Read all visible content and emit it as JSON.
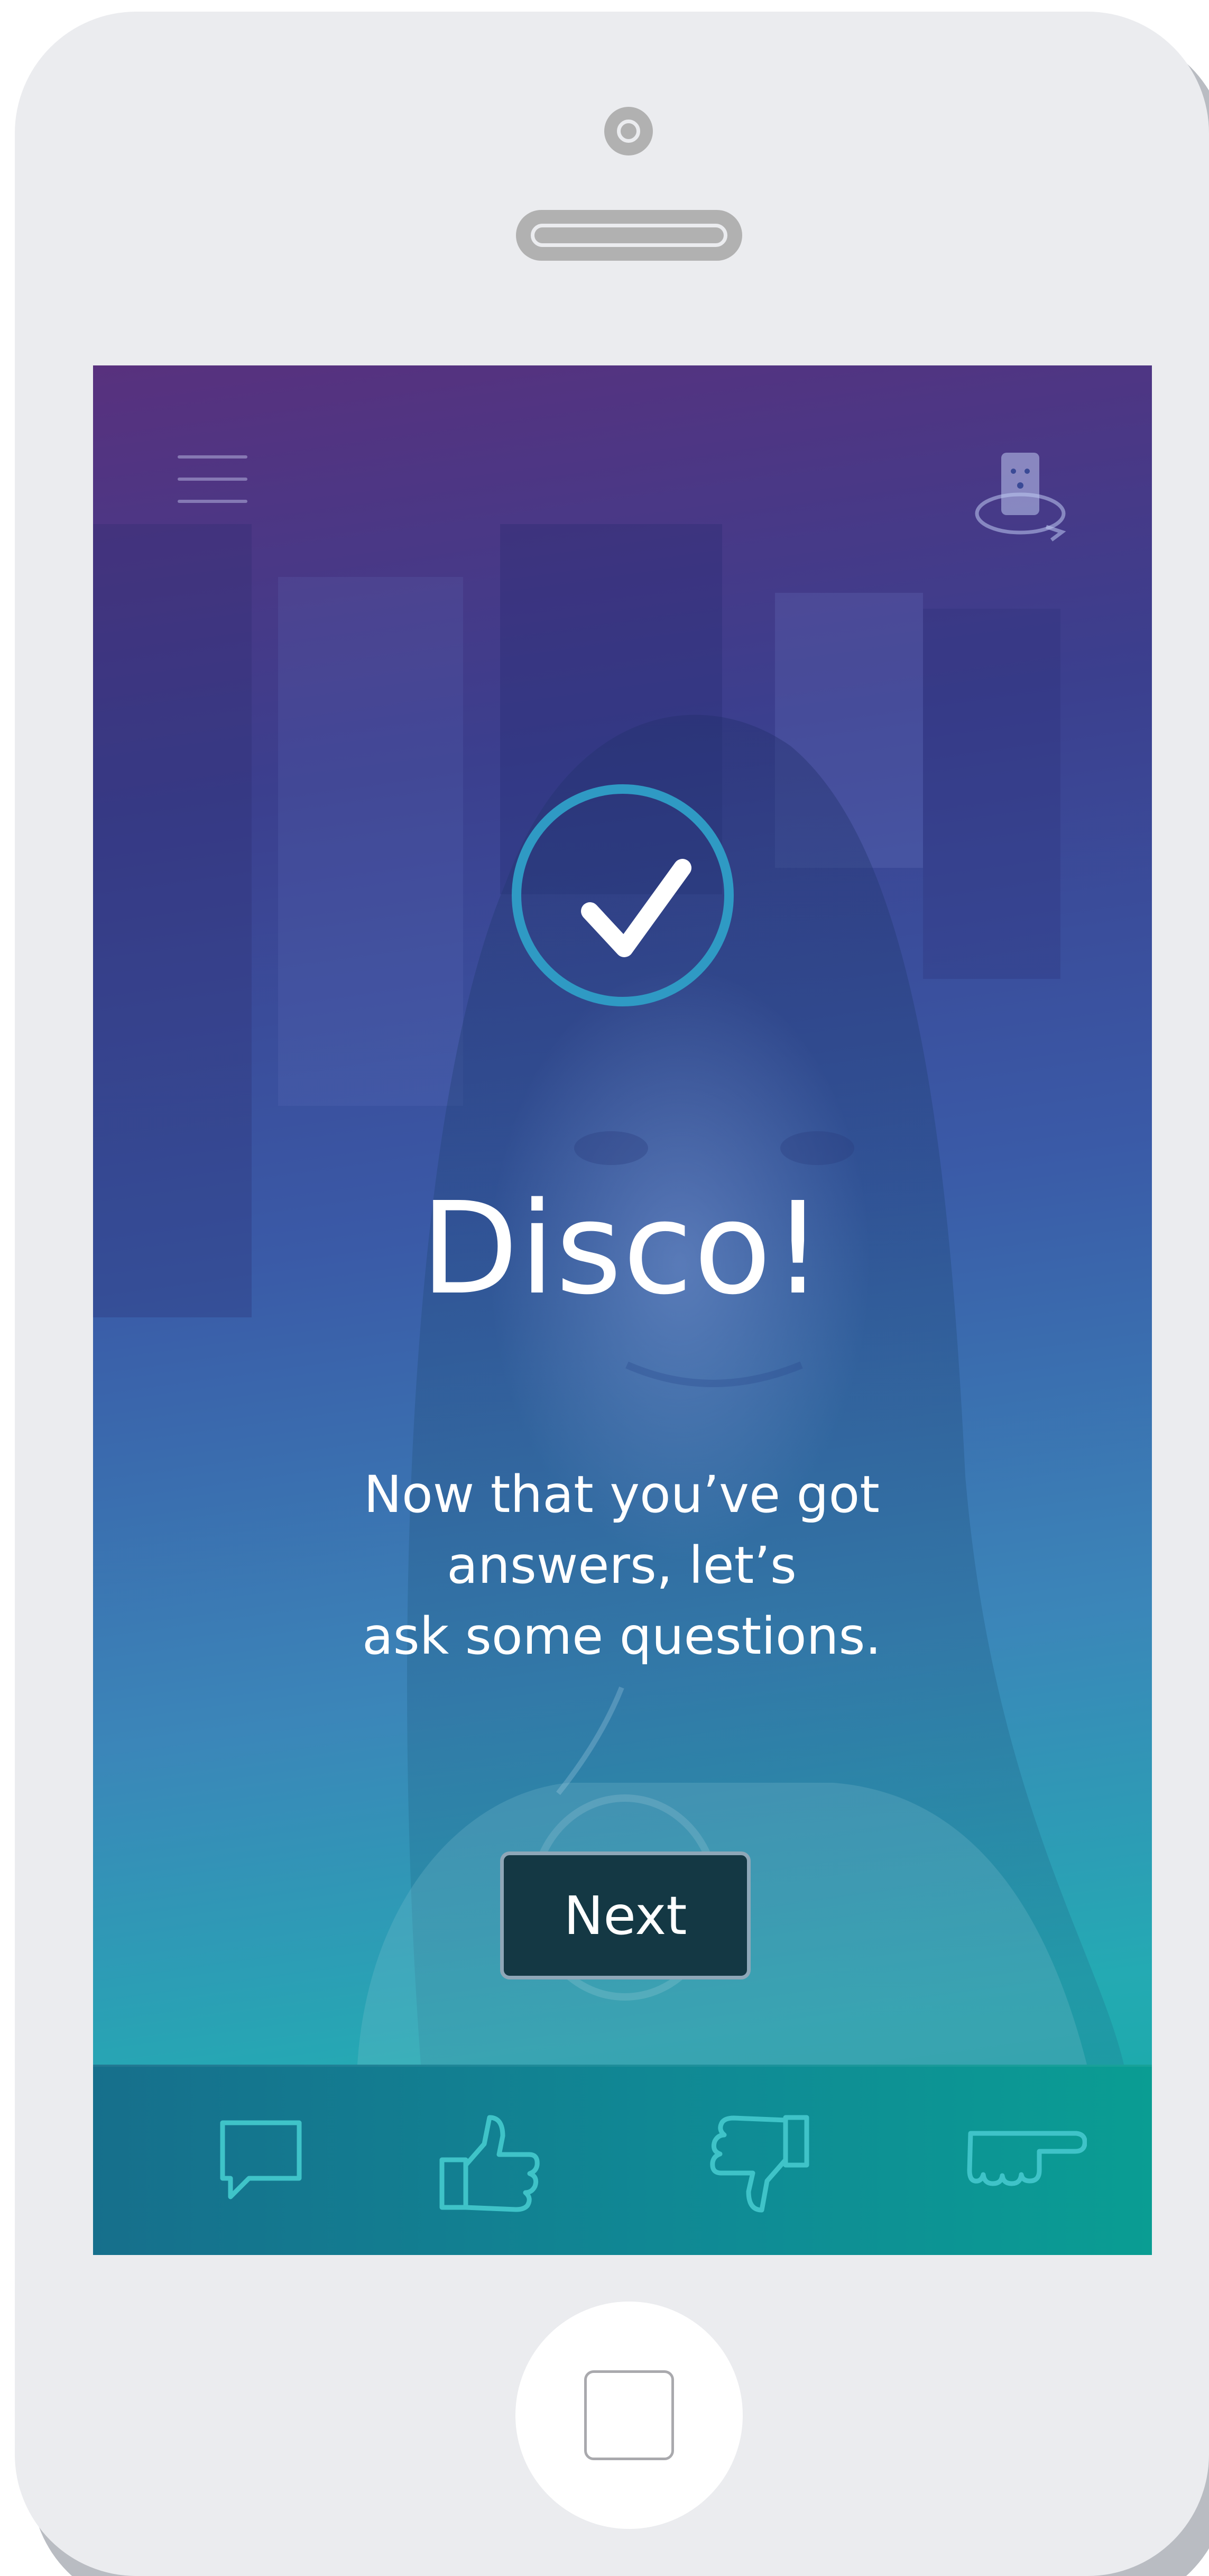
{
  "screen": {
    "headline": "Disco!",
    "message_lines": [
      "Now that you’ve got",
      "answers, let’s",
      "ask some questions."
    ],
    "next_label": "Next"
  },
  "icons": {
    "menu": "hamburger-menu-icon",
    "rotate": "rotate-phone-icon",
    "check": "checkmark-circle-icon",
    "bottom_bar": [
      "speech-bubble-icon",
      "thumbs-up-icon",
      "thumbs-down-icon",
      "pointing-hand-icon"
    ]
  },
  "colors": {
    "gradient_top": "#58317e",
    "gradient_bottom": "#11aba0",
    "check_ring": "#2f9ac4",
    "next_button_bg": "#143844",
    "bottom_bar": "#0f8b95",
    "bar_icon_stroke": "#3fc3c8",
    "phone_body": "#ebecef"
  }
}
